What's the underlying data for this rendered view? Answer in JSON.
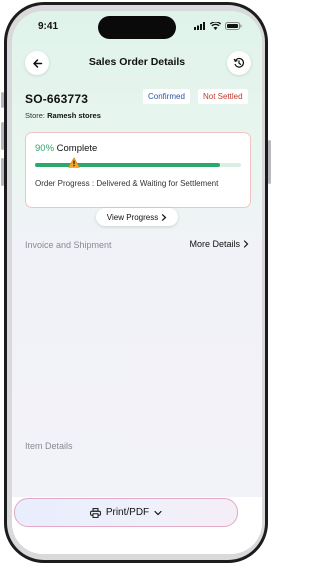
{
  "status_bar": {
    "time": "9:41"
  },
  "header": {
    "title": "Sales Order Details",
    "back_icon": "arrow-left-icon",
    "history_icon": "history-icon"
  },
  "order": {
    "id": "SO-663773",
    "badges": {
      "confirmed": "Confirmed",
      "not_settled": "Not Settled"
    },
    "store_label": "Store:",
    "store_name": "Ramesh stores"
  },
  "progress": {
    "percent_text": "90%",
    "complete_label": "Complete",
    "fraction": 0.9,
    "status_text": "Order Progress : Delivered & Waiting for Settlement",
    "view_button": "View Progress"
  },
  "sections": {
    "invoice": "Invoice and Shipment",
    "more_details": "More Details",
    "items": "Item Details"
  },
  "footer": {
    "print_button": "Print/PDF"
  },
  "colors": {
    "accent_green": "#2ea86a",
    "confirmed_blue": "#2a57a8",
    "not_settled_red": "#c0392b"
  }
}
